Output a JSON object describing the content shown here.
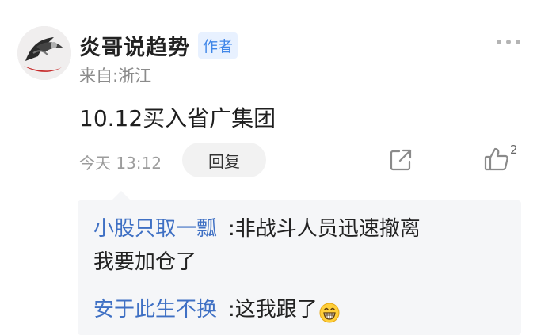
{
  "post": {
    "author": {
      "name": "炎哥说趋势",
      "badge": "作者",
      "location": "来自:浙江"
    },
    "content": "10.12买入省广集团",
    "timestamp": "今天 13:12",
    "reply_label": "回复",
    "like_count": "2"
  },
  "replies": [
    {
      "user": "小股只取一瓢",
      "colon": ":",
      "text_line1": "非战斗人员迅速撤离",
      "text_line2": "我要加仓了"
    },
    {
      "user": "安于此生不换",
      "colon": ":",
      "text": "这我跟了"
    }
  ],
  "icons": {
    "more": "more-dots-icon",
    "share": "share-icon",
    "like": "thumbs-up-icon",
    "emoji": "grinning-face-icon"
  },
  "colors": {
    "accent": "#3f86e8",
    "reply_user": "#3f70c4",
    "reply_bg": "#f5f6f8"
  }
}
